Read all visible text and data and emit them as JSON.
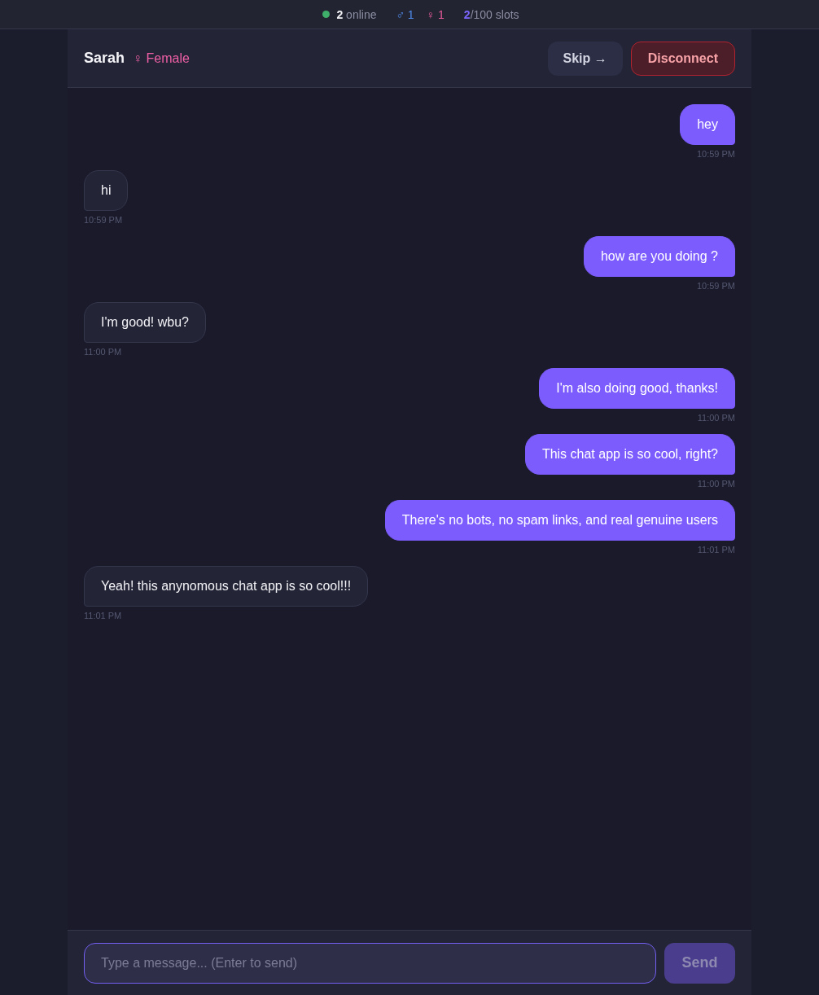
{
  "status_bar": {
    "online": "**2** online",
    "male": "♂ 1",
    "female": "♀ 1",
    "slots_used": "2",
    "slots_text": "/100 slots"
  },
  "chat_header": {
    "partner_name": "Sarah",
    "gender": "♀ Female",
    "skip_button": "Skip →",
    "disconnect_button": "Disconnect"
  },
  "messages": [
    {
      "kind": "sent",
      "text": "hey",
      "time": "10:59 PM"
    },
    {
      "kind": "received",
      "text": "hi",
      "time": "10:59 PM"
    },
    {
      "kind": "sent",
      "text": "how are you doing ?",
      "time": "10:59 PM"
    },
    {
      "kind": "received",
      "text": "I'm good! wbu?",
      "time": "11:00 PM"
    },
    {
      "kind": "sent",
      "text": "I'm also doing good, thanks!",
      "time": "11:00 PM"
    },
    {
      "kind": "sent",
      "text": "This chat app is so cool, right?",
      "time": "11:00 PM"
    },
    {
      "kind": "sent",
      "text": "There's no bots, no spam links, and real genuine users",
      "time": "11:01 PM"
    },
    {
      "kind": "received",
      "text": "Yeah! this anynomous chat app is so cool!!!",
      "time": "11:01 PM"
    }
  ],
  "composer": {
    "placeholder": "Type a message... (Enter to send)",
    "focused": true,
    "send_button": "Send",
    "send_disabled": true
  }
}
